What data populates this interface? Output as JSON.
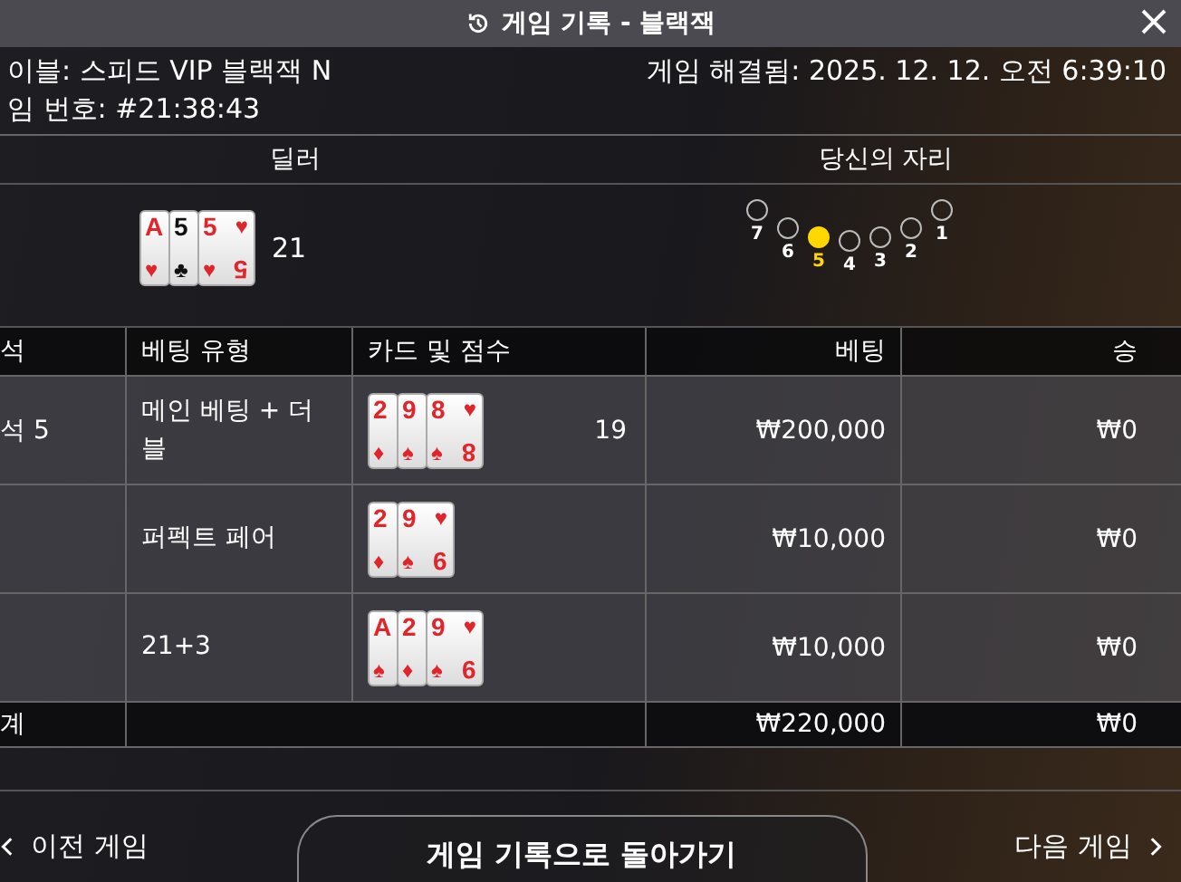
{
  "window": {
    "title": "게임 기록 - 블랙잭"
  },
  "info": {
    "table": "이블: 스피드 VIP 블랙잭 N",
    "resolved": "게임 해결됨: 2025. 12. 12. 오전 6:39:10",
    "game_number": "임 번호: #21:38:43"
  },
  "dealer": {
    "heading": "딜러",
    "score": "21",
    "cards": [
      {
        "rank": "A",
        "suit": "♥",
        "color": "#e0262b"
      },
      {
        "rank": "5",
        "suit": "♣",
        "color": "#111111"
      },
      {
        "rank": "5",
        "suit": "♥",
        "color": "#e0262b",
        "rank_corner": "5",
        "suit_corner": "♥"
      }
    ]
  },
  "seats": {
    "heading": "당신의 자리",
    "items": [
      {
        "label": "7",
        "selected": false
      },
      {
        "label": "6",
        "selected": false
      },
      {
        "label": "5",
        "selected": true
      },
      {
        "label": "4",
        "selected": false
      },
      {
        "label": "3",
        "selected": false
      },
      {
        "label": "2",
        "selected": false
      },
      {
        "label": "1",
        "selected": false
      }
    ]
  },
  "table": {
    "columns": [
      "석",
      "베팅 유형",
      "카드 및 점수",
      "베팅",
      "승"
    ],
    "rows": [
      {
        "seat": "석 5",
        "bet_type": "메인 베팅 + 더블",
        "score": "19",
        "bet": "₩200,000",
        "win": "₩0",
        "cards": [
          {
            "rank": "2",
            "suit": "♦",
            "color": "#e0262b"
          },
          {
            "rank": "9",
            "suit": "♠",
            "color": "#e0262b"
          },
          {
            "rank": "8",
            "suit": "♠",
            "color": "#e0262b",
            "rank_corner": "8",
            "suit_corner": "♥"
          }
        ]
      },
      {
        "seat": "",
        "bet_type": "퍼펙트 페어",
        "score": "",
        "bet": "₩10,000",
        "win": "₩0",
        "cards": [
          {
            "rank": "2",
            "suit": "♦",
            "color": "#e0262b"
          },
          {
            "rank": "9",
            "suit": "♠",
            "color": "#e0262b",
            "rank_corner": "9",
            "suit_corner": "♥"
          }
        ]
      },
      {
        "seat": "",
        "bet_type": "21+3",
        "score": "",
        "bet": "₩10,000",
        "win": "₩0",
        "cards": [
          {
            "rank": "A",
            "suit": "♠",
            "color": "#e0262b"
          },
          {
            "rank": "2",
            "suit": "♦",
            "color": "#e0262b"
          },
          {
            "rank": "9",
            "suit": "♠",
            "color": "#e0262b",
            "rank_corner": "9",
            "suit_corner": "♥"
          }
        ]
      }
    ],
    "total": {
      "label": "계",
      "bet": "₩220,000",
      "win": "₩0"
    }
  },
  "footer": {
    "previous": "이전 게임",
    "back": "게임 기록으로 돌아가기",
    "next": "다음 게임"
  }
}
